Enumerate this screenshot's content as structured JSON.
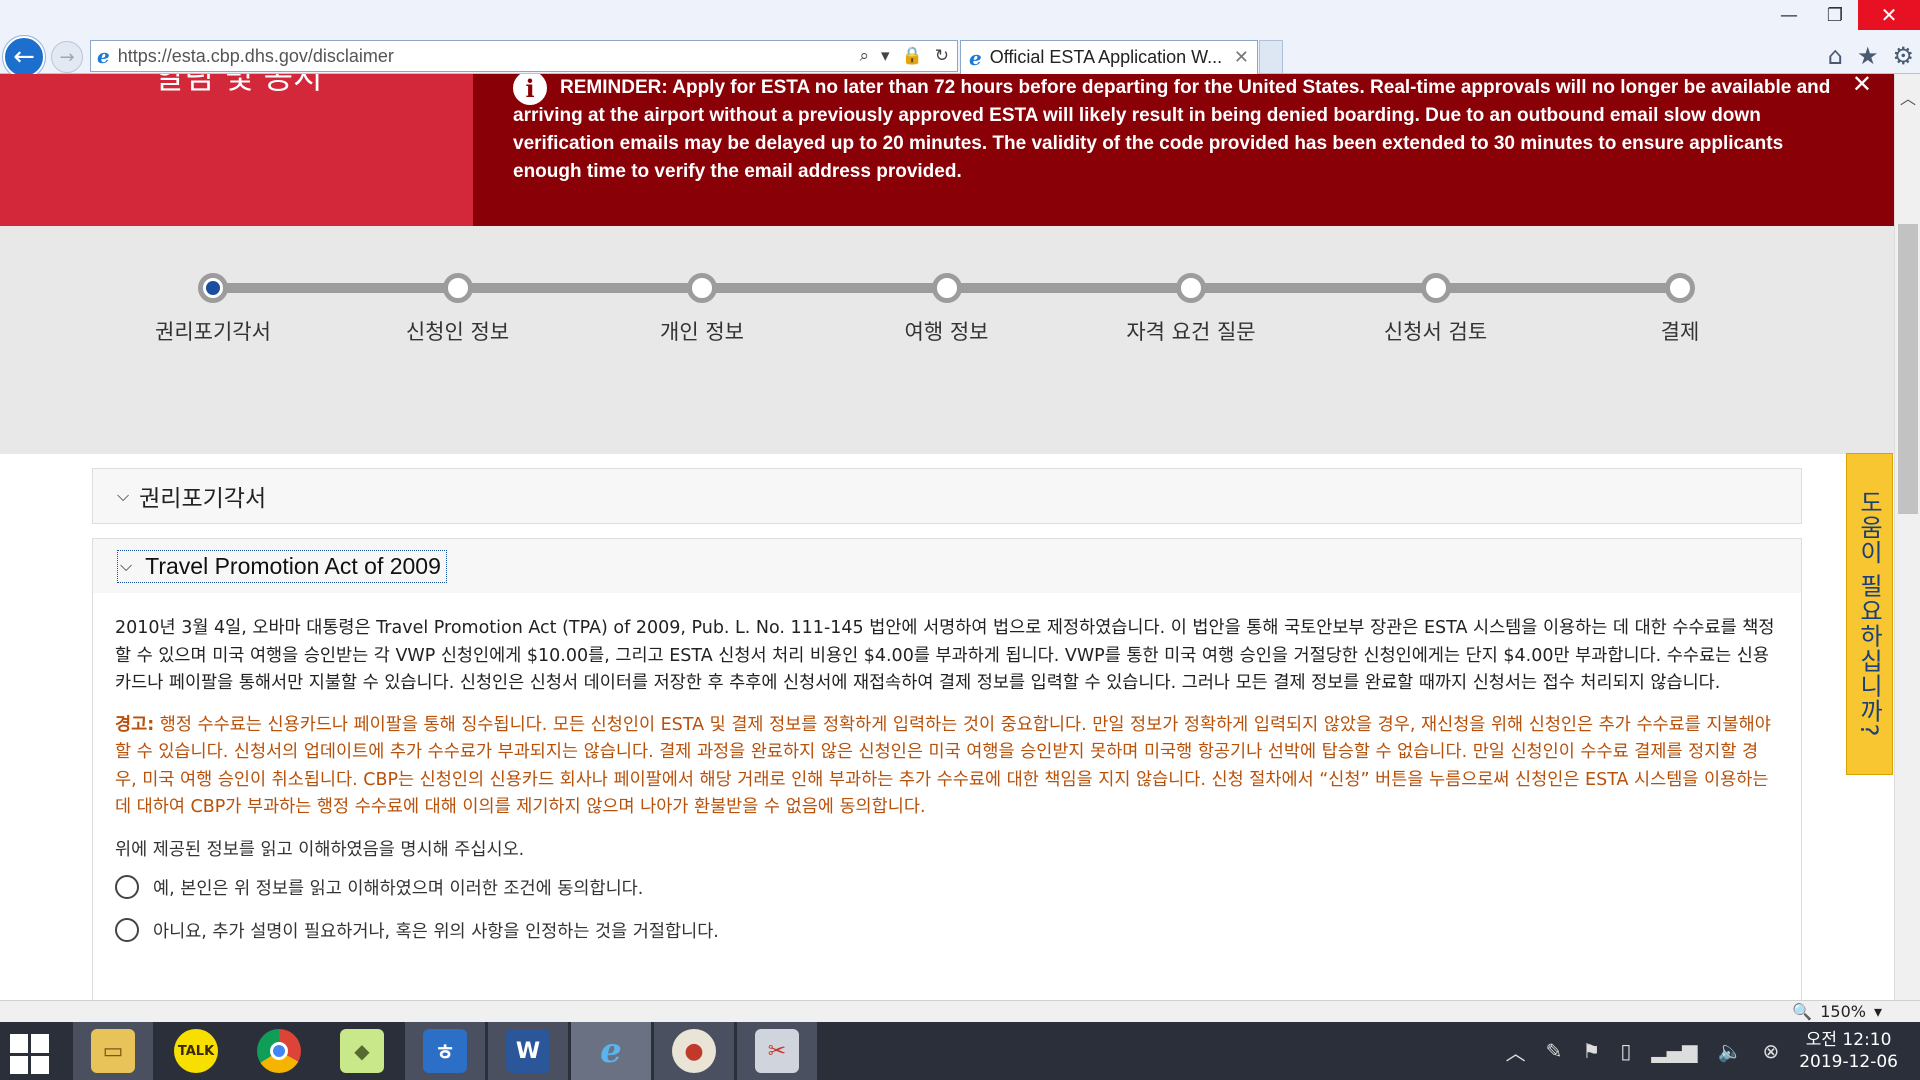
{
  "browser": {
    "url": "https://esta.cbp.dhs.gov/disclaimer",
    "tab_title": "Official ESTA Application W...",
    "zoom": "150%"
  },
  "banner": {
    "left_text": "알림 및 공지",
    "reminder": "REMINDER: Apply for ESTA no later than 72 hours before departing for the United States. Real-time approvals will no longer be available and arriving at the airport without a previously approved ESTA will likely result in being denied boarding. Due to an outbound email slow down verification emails may be delayed up to 20 minutes. The validity of the code provided has been extended to 30 minutes to ensure applicants enough time to verify the email address provided."
  },
  "steps": [
    {
      "label": "권리포기각서"
    },
    {
      "label": "신청인 정보"
    },
    {
      "label": "개인 정보"
    },
    {
      "label": "여행 정보"
    },
    {
      "label": "자격 요건 질문"
    },
    {
      "label": "신청서 검토"
    },
    {
      "label": "결제"
    }
  ],
  "accordion1": {
    "title": "권리포기각서"
  },
  "accordion2": {
    "title": "Travel Promotion Act of 2009",
    "paragraph": "2010년 3월 4일, 오바마 대통령은 Travel Promotion Act (TPA) of 2009, Pub. L. No. 111-145 법안에 서명하여 법으로 제정하였습니다. 이 법안을 통해 국토안보부 장관은 ESTA 시스템을 이용하는 데 대한 수수료를 책정할 수 있으며 미국 여행을 승인받는 각 VWP 신청인에게 $10.00를, 그리고 ESTA 신청서 처리 비용인 $4.00를 부과하게 됩니다. VWP를 통한 미국 여행 승인을 거절당한 신청인에게는 단지 $4.00만 부과합니다. 수수료는 신용카드나 페이팔을 통해서만 지불할 수 있습니다. 신청인은 신청서 데이터를 저장한 후 추후에 신청서에 재접속하여 결제 정보를 입력할 수 있습니다. 그러나 모든 결제 정보를 완료할 때까지 신청서는 접수 처리되지 않습니다.",
    "warning_label": "경고:",
    "warning": " 행정 수수료는 신용카드나 페이팔을 통해 징수됩니다. 모든 신청인이 ESTA 및 결제 정보를 정확하게 입력하는 것이 중요합니다. 만일 정보가 정확하게 입력되지 않았을 경우, 재신청을 위해 신청인은 추가 수수료를 지불해야 할 수 있습니다. 신청서의 업데이트에 추가 수수료가 부과되지는 않습니다. 결제 과정을 완료하지 않은 신청인은 미국 여행을 승인받지 못하며 미국행 항공기나 선박에 탑승할 수 없습니다. 만일 신청인이 수수료 결제를 정지할 경우, 미국 여행 승인이 취소됩니다. CBP는 신청인의 신용카드 회사나 페이팔에서 해당 거래로 인해 부과하는 추가 수수료에 대한 책임을 지지 않습니다. 신청 절차에서 “신청” 버튼을 누름으로써 신청인은 ESTA 시스템을 이용하는 데 대하여 CBP가 부과하는 행정 수수료에 대해 이의를 제기하지 않으며 나아가 환불받을 수 없음에 동의합니다.",
    "prompt": "위에 제공된 정보를 읽고 이해하였음을 명시해 주십시오.",
    "option_yes": "예, 본인은 위 정보를 읽고 이해하였으며 이러한 조건에 동의합니다.",
    "option_no": "아니요, 추가 설명이 필요하거나, 혹은 위의 사항을 인정하는 것을 거절합니다."
  },
  "help_tab": "도움이 필요하십니까?",
  "taskbar": {
    "apps": [
      {
        "icon": "file-explorer-icon"
      },
      {
        "icon": "kakaotalk-icon",
        "label": "TALK"
      },
      {
        "icon": "chrome-icon"
      },
      {
        "icon": "sticky-notes-icon"
      },
      {
        "icon": "hangul-word-icon"
      },
      {
        "icon": "ms-word-icon"
      },
      {
        "icon": "internet-explorer-icon"
      },
      {
        "icon": "paint-icon"
      },
      {
        "icon": "snipping-tool-icon"
      }
    ],
    "clock_time": "오전 12:10",
    "clock_date": "2019-12-06"
  },
  "colors": {
    "banner_left": "#d3283a",
    "banner_right": "#8a0007",
    "warning_text": "#b8510a",
    "active_step": "#1a4fa0",
    "help_tab": "#f7c631"
  }
}
